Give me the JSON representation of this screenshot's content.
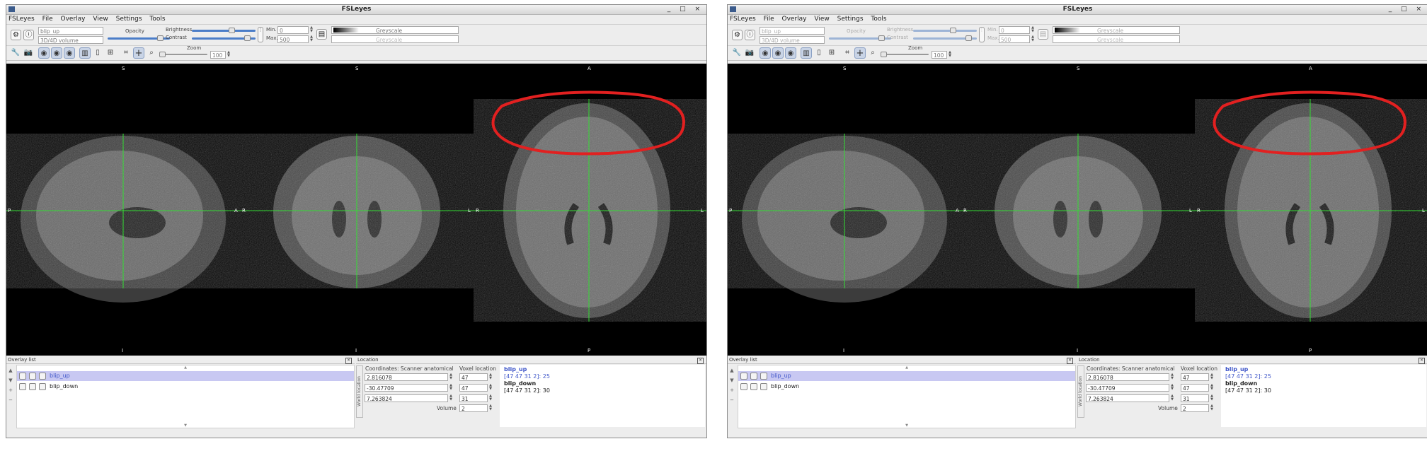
{
  "windows": [
    {
      "title": "FSLeyes",
      "window_controls": "_ □ ×",
      "menu": [
        "FSLeyes",
        "File",
        "Overlay",
        "View",
        "Settings",
        "Tools"
      ],
      "overlay_toolbar": {
        "name_value": "blip_up",
        "type_value": "3D/4D volume",
        "opacity_label": "Opacity",
        "brightness_label": "Brightness",
        "contrast_label": "Contrast",
        "min_label": "Min.",
        "max_label": "Max.",
        "min_value": "0",
        "max_value": "500",
        "cmap_value": "Greyscale",
        "neg_cmap_value": "Greyscale"
      },
      "ortho_toolbar": {
        "zoom_label": "Zoom",
        "zoom_value": "100"
      },
      "view_labels": {
        "sag_top": "S",
        "sag_bottom": "I",
        "sag_left": "P",
        "sag_right": "A",
        "cor_top": "S",
        "cor_bottom": "I",
        "cor_left": "R",
        "cor_right": "L",
        "ax_top": "A",
        "ax_bottom": "P",
        "ax_left": "R",
        "ax_right": "L"
      },
      "overlay_list": {
        "title": "Overlay list",
        "items": [
          {
            "name": "blip_up",
            "selected": true
          },
          {
            "name": "blip_down",
            "selected": false
          }
        ]
      },
      "location": {
        "title": "Location",
        "side_tab": "World location",
        "coords_label": "Coordinates: Scanner anatomical",
        "world": [
          "2.816078",
          "-30.47709",
          "7.263824"
        ],
        "voxel_label": "Voxel location",
        "voxel": [
          "47",
          "47",
          "31"
        ],
        "volume_label": "Volume",
        "volume_value": "2",
        "info": [
          {
            "name": "blip_up",
            "coords": "[47 47 31 2]: 25"
          },
          {
            "name": "blip_down",
            "coords": "[47 47 31 2]: 30"
          }
        ]
      }
    },
    {
      "title": "FSLeyes",
      "window_controls": "_ □ ×",
      "menu": [
        "FSLeyes",
        "File",
        "Overlay",
        "View",
        "Settings",
        "Tools"
      ],
      "overlay_toolbar": {
        "name_value": "blip_up",
        "type_value": "3D/4D volume",
        "opacity_label": "Opacity",
        "brightness_label": "Brightness",
        "contrast_label": "Contrast",
        "min_label": "Min.",
        "max_label": "Max.",
        "min_value": "0",
        "max_value": "500",
        "cmap_value": "Greyscale",
        "neg_cmap_value": "Greyscale"
      },
      "ortho_toolbar": {
        "zoom_label": "Zoom",
        "zoom_value": "100"
      },
      "view_labels": {
        "sag_top": "S",
        "sag_bottom": "I",
        "sag_left": "P",
        "sag_right": "A",
        "cor_top": "S",
        "cor_bottom": "I",
        "cor_left": "R",
        "cor_right": "L",
        "ax_top": "A",
        "ax_bottom": "P",
        "ax_left": "R",
        "ax_right": "L"
      },
      "overlay_list": {
        "title": "Overlay list",
        "items": [
          {
            "name": "blip_up",
            "selected": true
          },
          {
            "name": "blip_down",
            "selected": false
          }
        ]
      },
      "location": {
        "title": "Location",
        "side_tab": "World location",
        "coords_label": "Coordinates: Scanner anatomical",
        "world": [
          "2.816078",
          "-30.47709",
          "7.263824"
        ],
        "voxel_label": "Voxel location",
        "voxel": [
          "47",
          "47",
          "31"
        ],
        "volume_label": "Volume",
        "volume_value": "2",
        "info": [
          {
            "name": "blip_up",
            "coords": "[47 47 31 2]: 25"
          },
          {
            "name": "blip_down",
            "coords": "[47 47 31 2]: 30"
          }
        ]
      }
    }
  ],
  "colors": {
    "crosshair": "#33dd33",
    "annotation": "#e22020",
    "selection": "#c8c8f2",
    "info_blue": "#3f56c9"
  }
}
